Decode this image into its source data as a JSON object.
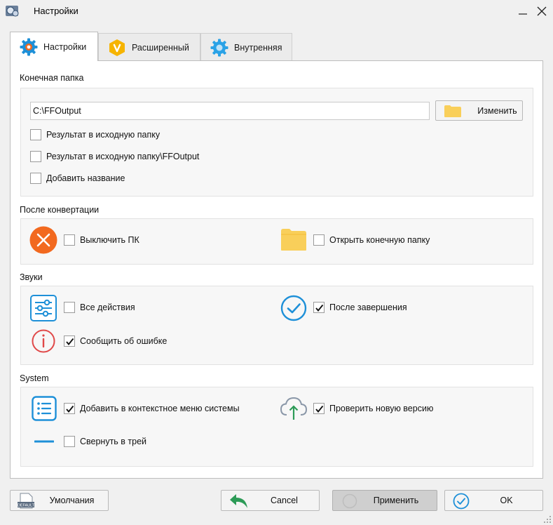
{
  "window": {
    "title": "Настройки"
  },
  "tabs": [
    {
      "label": "Настройки",
      "icon": "gear-icon",
      "active": true
    },
    {
      "label": "Расширенный",
      "icon": "v-badge-icon",
      "active": false
    },
    {
      "label": "Внутренняя",
      "icon": "gear-icon",
      "active": false
    }
  ],
  "output_folder": {
    "label": "Конечная папка",
    "path": "C:\\FFOutput",
    "change_button": "Изменить",
    "options": [
      {
        "label": "Результат в исходную папку",
        "checked": false
      },
      {
        "label": "Результат в исходную папку\\FFOutput",
        "checked": false
      },
      {
        "label": "Добавить название",
        "checked": false
      }
    ]
  },
  "after_conversion": {
    "label": "После конвертации",
    "shutdown": {
      "label": "Выключить ПК",
      "checked": false
    },
    "open_folder": {
      "label": "Открыть конечную папку",
      "checked": false
    }
  },
  "sounds": {
    "label": "Звуки",
    "all_actions": {
      "label": "Все действия",
      "checked": false
    },
    "after_finish": {
      "label": "После завершения",
      "checked": true
    },
    "on_error": {
      "label": "Сообщить об ошибке",
      "checked": true
    }
  },
  "system": {
    "label": "System",
    "context_menu": {
      "label": "Добавить в контекстное меню системы",
      "checked": true
    },
    "check_update": {
      "label": "Проверить новую версию",
      "checked": true
    },
    "minimize_tray": {
      "label": "Свернуть в трей",
      "checked": false
    }
  },
  "footer": {
    "defaults_button": "Умолчания",
    "defaults_badge": "DEFAULT",
    "cancel_button": "Cancel",
    "apply_button": "Применить",
    "ok_button": "OK"
  },
  "colors": {
    "accent_blue": "#1e90d8",
    "orange": "#f2691f",
    "yellow": "#f6b400",
    "folder": "#f9cf5a",
    "error_red": "#e04848",
    "green_arrow": "#2d9b57"
  }
}
